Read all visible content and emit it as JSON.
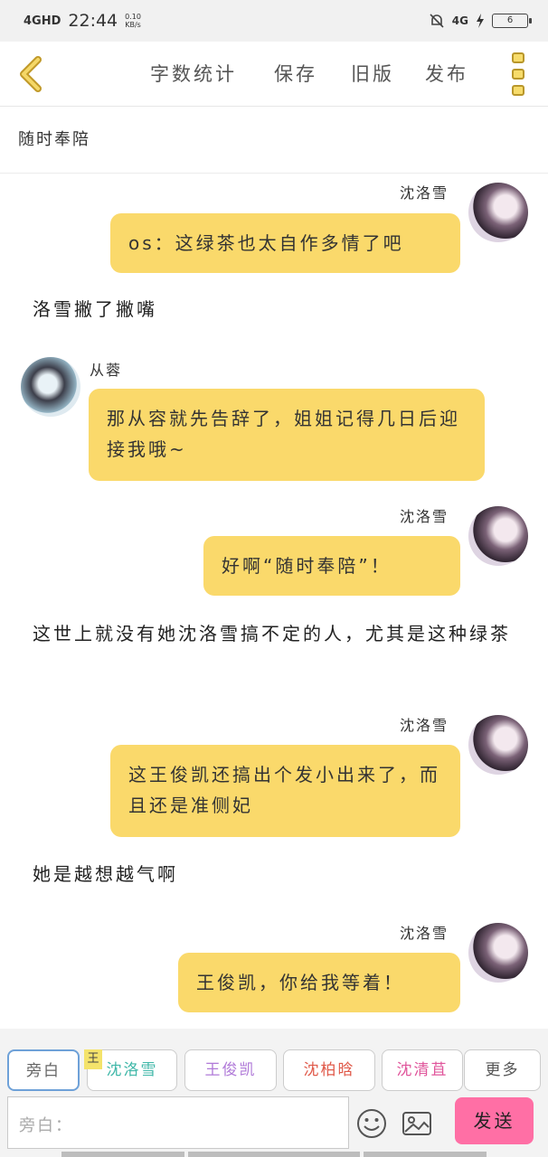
{
  "status_bar": {
    "network": "4GHD",
    "time": "22:44",
    "speed": "0.10",
    "speed_unit": "KB/s",
    "network_right": "4G",
    "battery": "6"
  },
  "toolbar": {
    "word_count": "字数统计",
    "save": "保存",
    "old_version": "旧版",
    "publish": "发布"
  },
  "chapter_title": "随时奉陪",
  "messages": [
    {
      "type": "bubble",
      "side": "right",
      "sender": "沈洛雪",
      "text": "os：这绿茶也太自作多情了吧"
    },
    {
      "type": "narration",
      "text": "洛雪撇了撇嘴"
    },
    {
      "type": "bubble",
      "side": "left",
      "sender": "从蓉",
      "text": "那从容就先告辞了，姐姐记得几日后迎接我哦~"
    },
    {
      "type": "bubble",
      "side": "right",
      "sender": "沈洛雪",
      "text": "好啊“随时奉陪”！"
    },
    {
      "type": "narration",
      "text": "这世上就没有她沈洛雪搞不定的人，尤其是这种绿茶"
    },
    {
      "type": "bubble",
      "side": "right",
      "sender": "沈洛雪",
      "text": "这王俊凯还搞出个发小出来了，而且还是准侧妃"
    },
    {
      "type": "narration",
      "text": "她是越想越气啊"
    },
    {
      "type": "bubble",
      "side": "right",
      "sender": "沈洛雪",
      "text": "王俊凯，你给我等着！"
    }
  ],
  "character_chips": [
    {
      "label": "旁白",
      "color": "#666666"
    },
    {
      "label": "沈洛雪",
      "color": "#3fb7a8"
    },
    {
      "label": "王俊凯",
      "color": "#b07ad8"
    },
    {
      "label": "沈柏晗",
      "color": "#e05a4a"
    },
    {
      "label": "沈清苴",
      "color": "#e0559b"
    },
    {
      "label": "更多",
      "color": "#555555"
    }
  ],
  "king_badge": "王",
  "input": {
    "placeholder": "旁白："
  },
  "send_label": "发送"
}
